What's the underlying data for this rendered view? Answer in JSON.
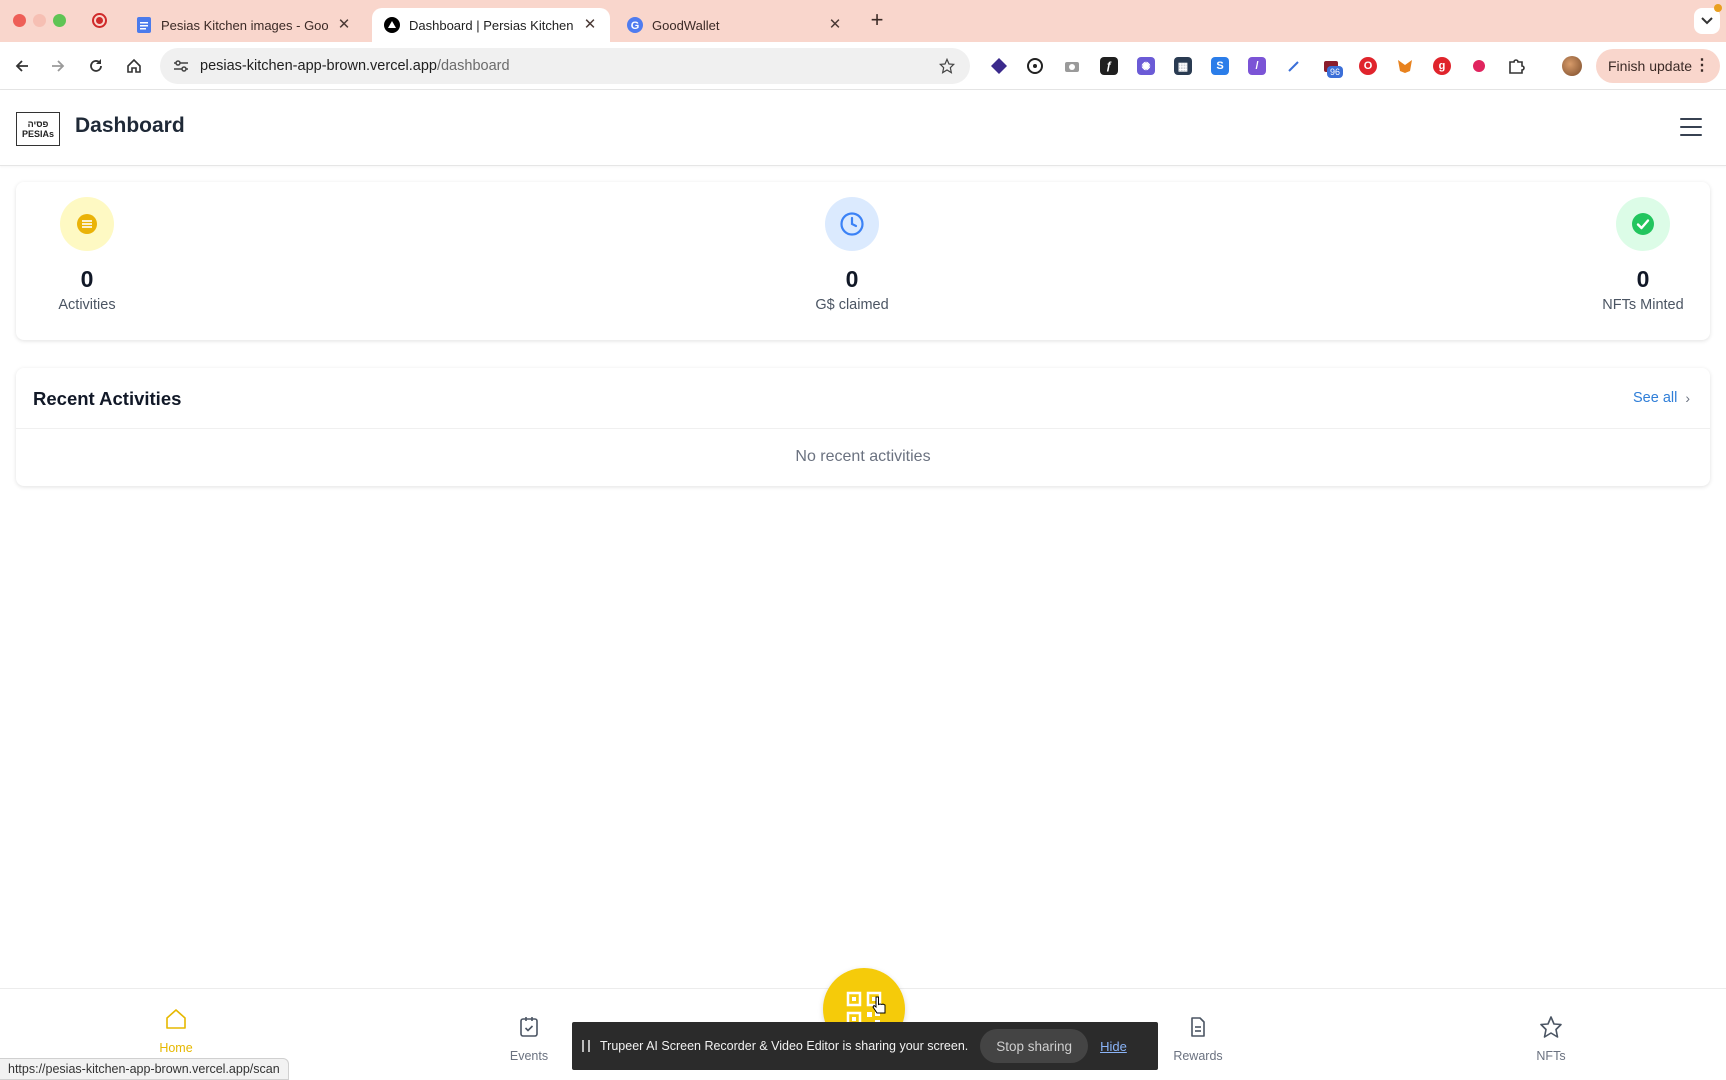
{
  "browser": {
    "tabs": [
      {
        "title": "Pesias Kitchen images - Goog",
        "favicon": "docs-icon"
      },
      {
        "title": "Dashboard | Persias Kitchen",
        "favicon": "vercel-icon"
      },
      {
        "title": "GoodWallet",
        "favicon": "google-icon"
      }
    ],
    "address": {
      "host": "pesias-kitchen-app-brown.vercel.app",
      "path": "/dashboard"
    },
    "extension_badge": "96",
    "finish_update_label": "Finish update"
  },
  "header": {
    "logo": {
      "line1": "פסיה",
      "line2": "PESIAs"
    },
    "title": "Dashboard"
  },
  "stats": [
    {
      "value": "0",
      "label": "Activities",
      "icon": "list-icon",
      "color": "#eab308",
      "bg": "#fef9c3"
    },
    {
      "value": "0",
      "label": "G$ claimed",
      "icon": "clock-icon",
      "color": "#3b82f6",
      "bg": "#dbeafe"
    },
    {
      "value": "0",
      "label": "NFTs Minted",
      "icon": "check-circle-icon",
      "color": "#22c55e",
      "bg": "#dcfce7"
    }
  ],
  "recent": {
    "title": "Recent Activities",
    "see_all": "See all",
    "empty": "No recent activities"
  },
  "bottom_nav": [
    {
      "label": "Home",
      "icon": "home-icon",
      "active": true
    },
    {
      "label": "Events",
      "icon": "calendar-check-icon",
      "active": false
    },
    {
      "label": "Rewards",
      "icon": "document-icon",
      "active": false
    },
    {
      "label": "NFTs",
      "icon": "star-icon",
      "active": false
    }
  ],
  "accent_color": "#f5cb0a",
  "screen_share": {
    "message": "Trupeer AI Screen Recorder & Video Editor is sharing your screen.",
    "stop_label": "Stop sharing",
    "hide_label": "Hide"
  },
  "status_url": "https://pesias-kitchen-app-brown.vercel.app/scan"
}
